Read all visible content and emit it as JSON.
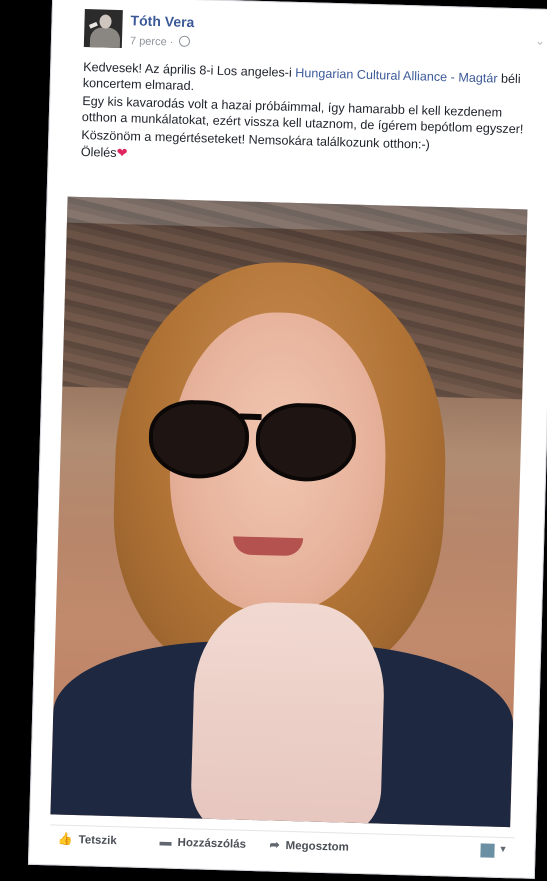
{
  "post": {
    "author": "Tóth Vera",
    "time": "7 perce ·",
    "paragraphs": [
      {
        "pre": "Kedvesek! Az április 8-i Los angeles-i ",
        "link": "Hungarian Cultural Alliance - Magtár",
        "post": " béli koncertem elmarad."
      },
      {
        "text": "Egy kis kavarodás volt a hazai próbáimmal, így hamarabb el kell kezdenem otthon a munkálatokat, ezért vissza kell utaznom, de ígérem bepótlom egyszer!"
      },
      {
        "text": "Köszönöm a megértéseteket! Nemsokára találkozunk otthon:-)"
      },
      {
        "text": "Ölelés",
        "emoji": "❤"
      }
    ]
  },
  "actions": {
    "like": "Tetszik",
    "comment": "Hozzászólás",
    "share": "Megosztom"
  },
  "icons": {
    "like": "thumbs-up-icon",
    "comment": "speech-bubble-icon",
    "share": "share-arrow-icon",
    "privacy": "globe-icon",
    "menu": "chevron-down-icon"
  },
  "colors": {
    "link": "#3b5998",
    "heart": "#e0245e"
  }
}
